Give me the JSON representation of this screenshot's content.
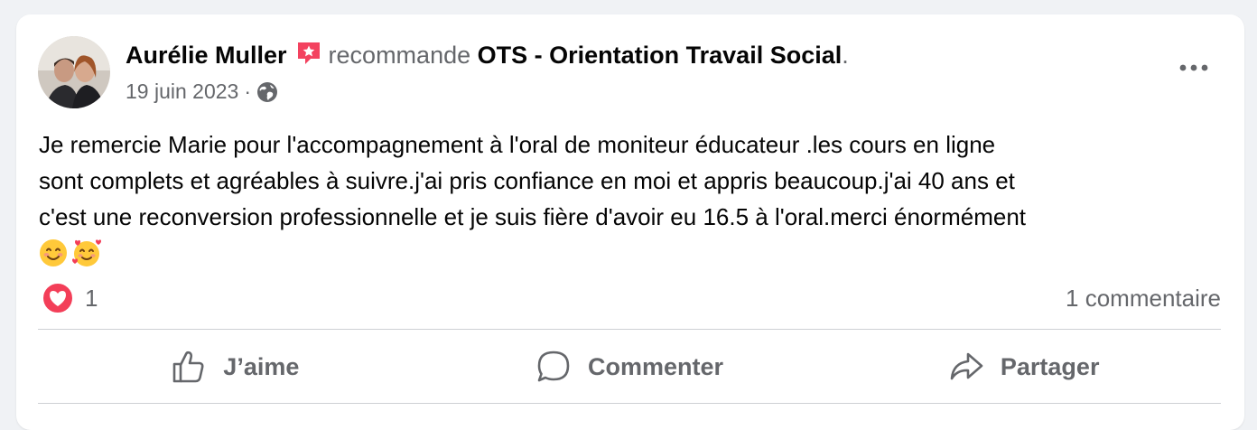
{
  "post": {
    "author": "Aurélie Muller",
    "verb": "recommande",
    "page_name": "OTS - Orientation Travail Social",
    "trailing_dot": ".",
    "date": "19 juin 2023",
    "separator": "·",
    "text_lines": [
      "Je remercie Marie pour l'accompagnement à l'oral de moniteur éducateur .les cours en ligne",
      "sont complets et agréables à suivre.j'ai pris confiance en moi et appris beaucoup.j'ai 40 ans et",
      "c'est une reconversion professionnelle et je suis fière d'avoir eu 16.5 à l'oral.merci énormément"
    ],
    "emojis": [
      "smiling-face-icon",
      "smiling-face-with-hearts-icon"
    ]
  },
  "stats": {
    "reaction_count": "1",
    "comments": "1 commentaire"
  },
  "actions": {
    "like": "J’aime",
    "comment": "Commenter",
    "share": "Partager"
  },
  "colors": {
    "secondary_text": "#65676b",
    "recommend_badge": "#f3425f",
    "love_reaction": "#f33e58",
    "divider": "#ced0d4"
  }
}
